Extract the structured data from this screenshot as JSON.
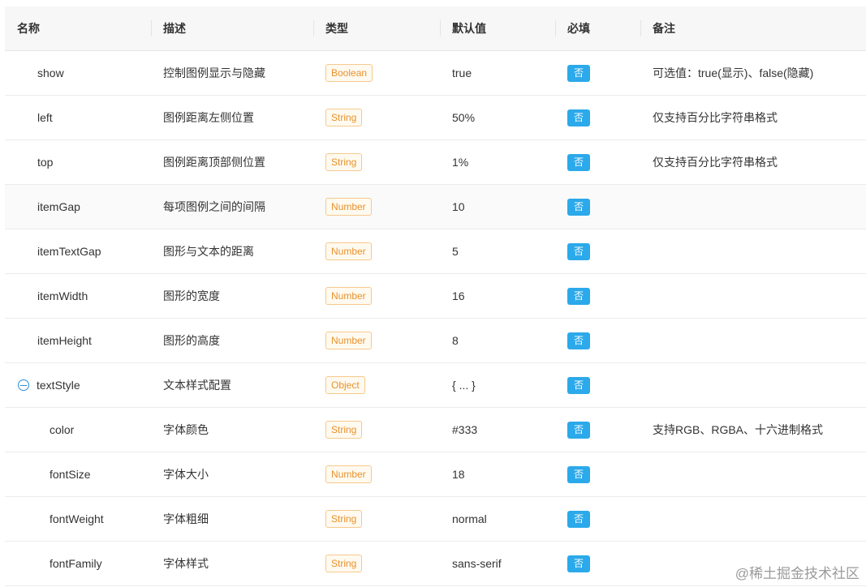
{
  "header": {
    "name": "名称",
    "desc": "描述",
    "type": "类型",
    "default": "默认值",
    "required": "必填",
    "note": "备注"
  },
  "rows": [
    {
      "name": "show",
      "desc": "控制图例显示与隐藏",
      "type": "Boolean",
      "default": "true",
      "required": "否",
      "note": "可选值：true(显示)、false(隐藏)"
    },
    {
      "name": "left",
      "desc": "图例距离左侧位置",
      "type": "String",
      "default": "50%",
      "required": "否",
      "note": "仅支持百分比字符串格式"
    },
    {
      "name": "top",
      "desc": "图例距离顶部侧位置",
      "type": "String",
      "default": "1%",
      "required": "否",
      "note": "仅支持百分比字符串格式"
    },
    {
      "name": "itemGap",
      "desc": "每项图例之间的间隔",
      "type": "Number",
      "default": "10",
      "required": "否",
      "note": ""
    },
    {
      "name": "itemTextGap",
      "desc": "图形与文本的距离",
      "type": "Number",
      "default": "5",
      "required": "否",
      "note": ""
    },
    {
      "name": "itemWidth",
      "desc": "图形的宽度",
      "type": "Number",
      "default": "16",
      "required": "否",
      "note": ""
    },
    {
      "name": "itemHeight",
      "desc": "图形的高度",
      "type": "Number",
      "default": "8",
      "required": "否",
      "note": ""
    },
    {
      "name": "textStyle",
      "desc": "文本样式配置",
      "type": "Object",
      "default": "{ ... }",
      "required": "否",
      "note": ""
    },
    {
      "name": "color",
      "desc": "字体颜色",
      "type": "String",
      "default": "#333",
      "required": "否",
      "note": "支持RGB、RGBA、十六进制格式"
    },
    {
      "name": "fontSize",
      "desc": "字体大小",
      "type": "Number",
      "default": "18",
      "required": "否",
      "note": ""
    },
    {
      "name": "fontWeight",
      "desc": "字体粗细",
      "type": "String",
      "default": "normal",
      "required": "否",
      "note": ""
    },
    {
      "name": "fontFamily",
      "desc": "字体样式",
      "type": "String",
      "default": "sans-serif",
      "required": "否",
      "note": ""
    }
  ],
  "watermark": "@稀土掘金技术社区"
}
